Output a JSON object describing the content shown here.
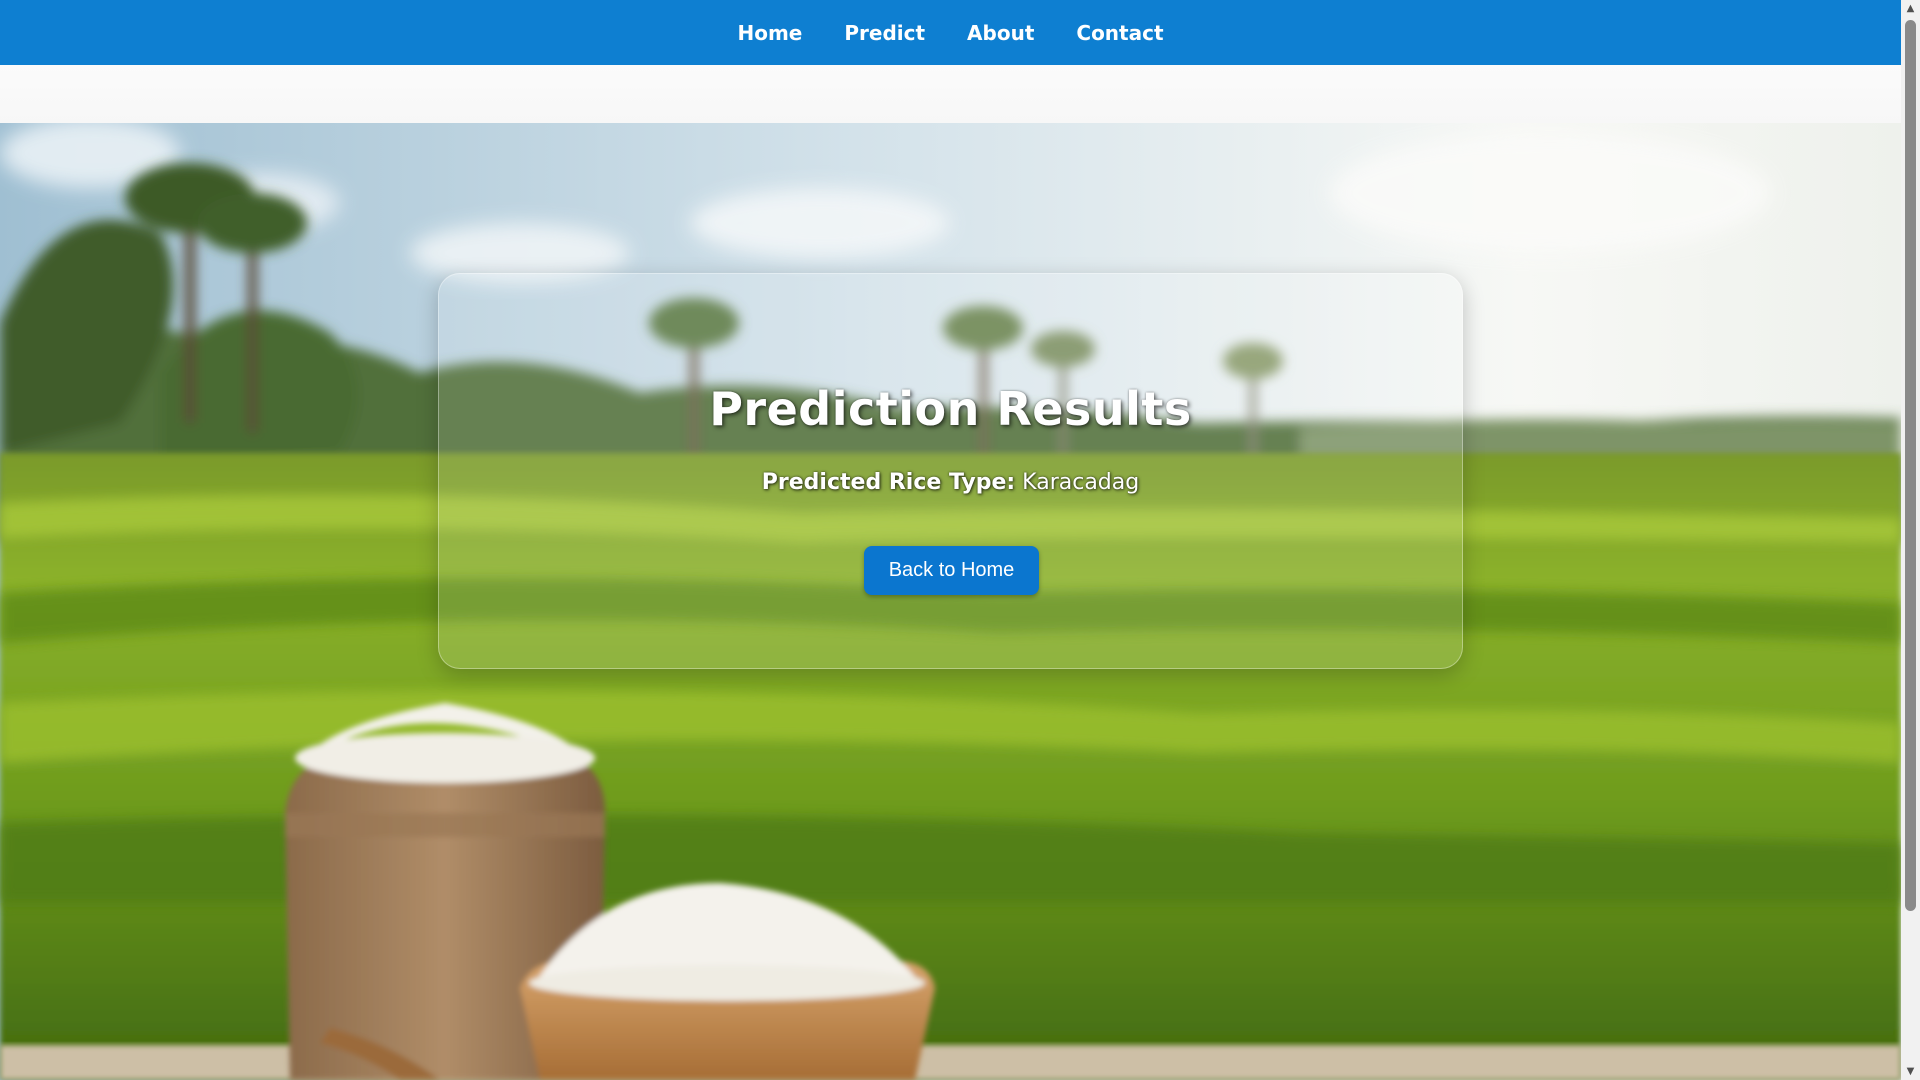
{
  "nav": {
    "items": [
      {
        "label": "Home"
      },
      {
        "label": "Predict"
      },
      {
        "label": "About"
      },
      {
        "label": "Contact"
      }
    ]
  },
  "result": {
    "title": "Prediction Results",
    "prediction_label": "Predicted Rice Type:",
    "prediction_value": "Karacadag",
    "back_button_label": "Back to Home"
  },
  "colors": {
    "nav_background": "#0e7fd1",
    "button_background": "#0b76cf"
  }
}
